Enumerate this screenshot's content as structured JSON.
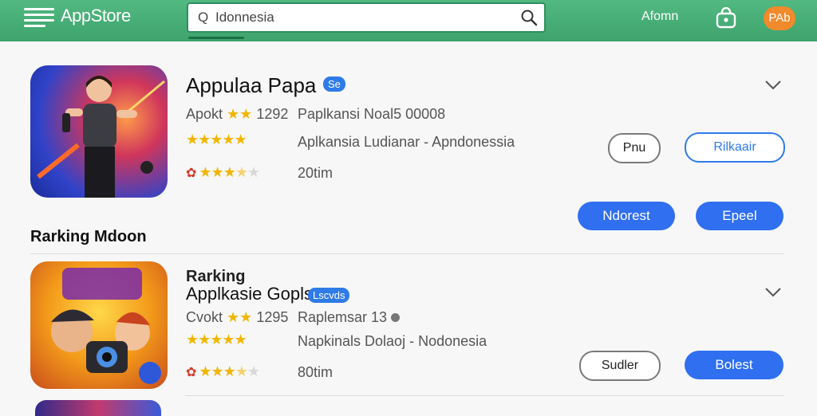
{
  "header": {
    "brand": "AppStore",
    "search_value": "Idonnesia",
    "user_label": "Afomn",
    "avatar_label": "PAb"
  },
  "apps": [
    {
      "title": "Appulaa Papa",
      "badge": "Se",
      "developer": "Apokt",
      "dev_rating": "1292",
      "meta1": "Paplkansi Noal5 00008",
      "meta2": "Aplkansia Ludianar - Apndonessia",
      "rating_count": "20tim",
      "stars_full": 5,
      "stars_partial": 3.5,
      "btn_outline_1": "Pnu",
      "btn_outline_2": "Rilkaair",
      "btn_fill_1": "Ndorest",
      "btn_fill_2": "Epeel"
    },
    {
      "kicker": "Rarking",
      "title": "Applkasie Gopls",
      "badge": "Lscvds",
      "developer": "Cvokt",
      "dev_rating": "1295",
      "meta1": "Raplemsar 13",
      "meta2": "Napkinals Dolaoj - Nodonesia",
      "rating_count": "80tim",
      "stars_full": 5,
      "stars_partial": 3.5,
      "btn_outline_1": "Sudler",
      "btn_fill_1": "Bolest"
    }
  ],
  "section_heading": "Rarking Mdoon",
  "colors": {
    "header_green": "#46ad76",
    "accent_blue": "#2f6ff0",
    "star_gold": "#f2b600",
    "avatar_orange": "#f08a2c"
  }
}
